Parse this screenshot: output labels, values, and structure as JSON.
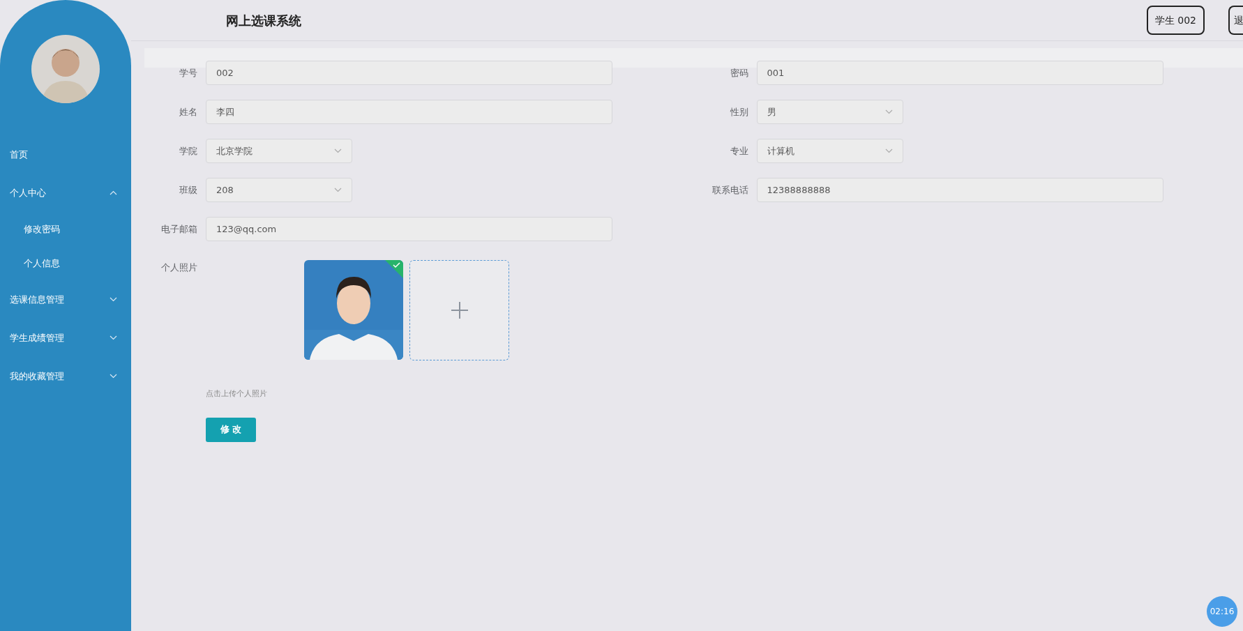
{
  "header": {
    "title": "网上选课系统",
    "user_button": "学生 002",
    "logout_button": "退"
  },
  "sidebar": {
    "items": [
      {
        "label": "首页",
        "kind": "link"
      },
      {
        "label": "个人中心",
        "kind": "group",
        "expanded": true,
        "children": [
          {
            "label": "修改密码"
          },
          {
            "label": "个人信息"
          }
        ]
      },
      {
        "label": "选课信息管理",
        "kind": "group",
        "expanded": false
      },
      {
        "label": "学生成绩管理",
        "kind": "group",
        "expanded": false
      },
      {
        "label": "我的收藏管理",
        "kind": "group",
        "expanded": false
      }
    ]
  },
  "form": {
    "rows": [
      [
        {
          "label": "学号",
          "value": "002",
          "kind": "input"
        },
        {
          "label": "密码",
          "value": "001",
          "kind": "input"
        }
      ],
      [
        {
          "label": "姓名",
          "value": "李四",
          "kind": "input"
        },
        {
          "label": "性别",
          "value": "男",
          "kind": "select"
        }
      ],
      [
        {
          "label": "学院",
          "value": "北京学院",
          "kind": "select"
        },
        {
          "label": "专业",
          "value": "计算机",
          "kind": "select"
        }
      ],
      [
        {
          "label": "班级",
          "value": "208",
          "kind": "select"
        },
        {
          "label": "联系电话",
          "value": "12388888888",
          "kind": "input"
        }
      ],
      [
        {
          "label": "电子邮箱",
          "value": "123@qq.com",
          "kind": "input"
        }
      ]
    ],
    "photo": {
      "label": "个人照片",
      "uploaded": true,
      "hint": "点击上传个人照片"
    },
    "submit_button": "修 改"
  },
  "timer": "02:16"
}
